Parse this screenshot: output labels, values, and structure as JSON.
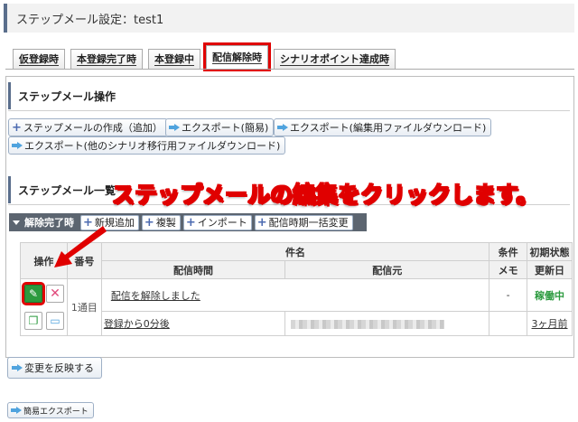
{
  "page_title": "ステップメール設定：test1",
  "tabs": [
    {
      "label": "仮登録時"
    },
    {
      "label": "本登録完了時"
    },
    {
      "label": "本登録中"
    },
    {
      "label": "配信解除時"
    },
    {
      "label": "シナリオポイント達成時"
    }
  ],
  "ops_section": {
    "title": "ステップメール操作",
    "buttons": {
      "create": "ステップメールの作成（追加）",
      "export_simple": "エクスポート(簡易)",
      "export_edit": "エクスポート(編集用ファイルダウンロード)",
      "export_other": "エクスポート(他のシナリオ移行用ファイルダウンロード)"
    }
  },
  "list_section": {
    "title": "ステップメール一覧"
  },
  "callout": "ステップメールの編集をクリックします。",
  "toolbar": {
    "label": "解除完了時",
    "new": "新規追加",
    "copy": "複製",
    "import": "インポート",
    "bulk_change": "配信時期一括変更"
  },
  "table": {
    "headers": {
      "ops": "操作",
      "num": "番号",
      "subject": "件名",
      "condition": "条件",
      "initial_state": "初期状態",
      "send_time": "配信時間",
      "sender": "配信元",
      "memo": "メモ",
      "updated": "更新日"
    },
    "rows": [
      {
        "number": "1通目",
        "subject": "配信を解除しました",
        "condition": "-",
        "status": "稼働中",
        "send_time": "登録から0分後",
        "updated": "3ヶ月前"
      }
    ]
  },
  "apply_button": "変更を反映する",
  "simple_export_button": "簡易エクスポート",
  "colors": {
    "accent_red": "#e00000",
    "header_bar": "#5a6e8c",
    "toolbar_bg": "#5c6570",
    "status_green": "#2b9a3e"
  }
}
